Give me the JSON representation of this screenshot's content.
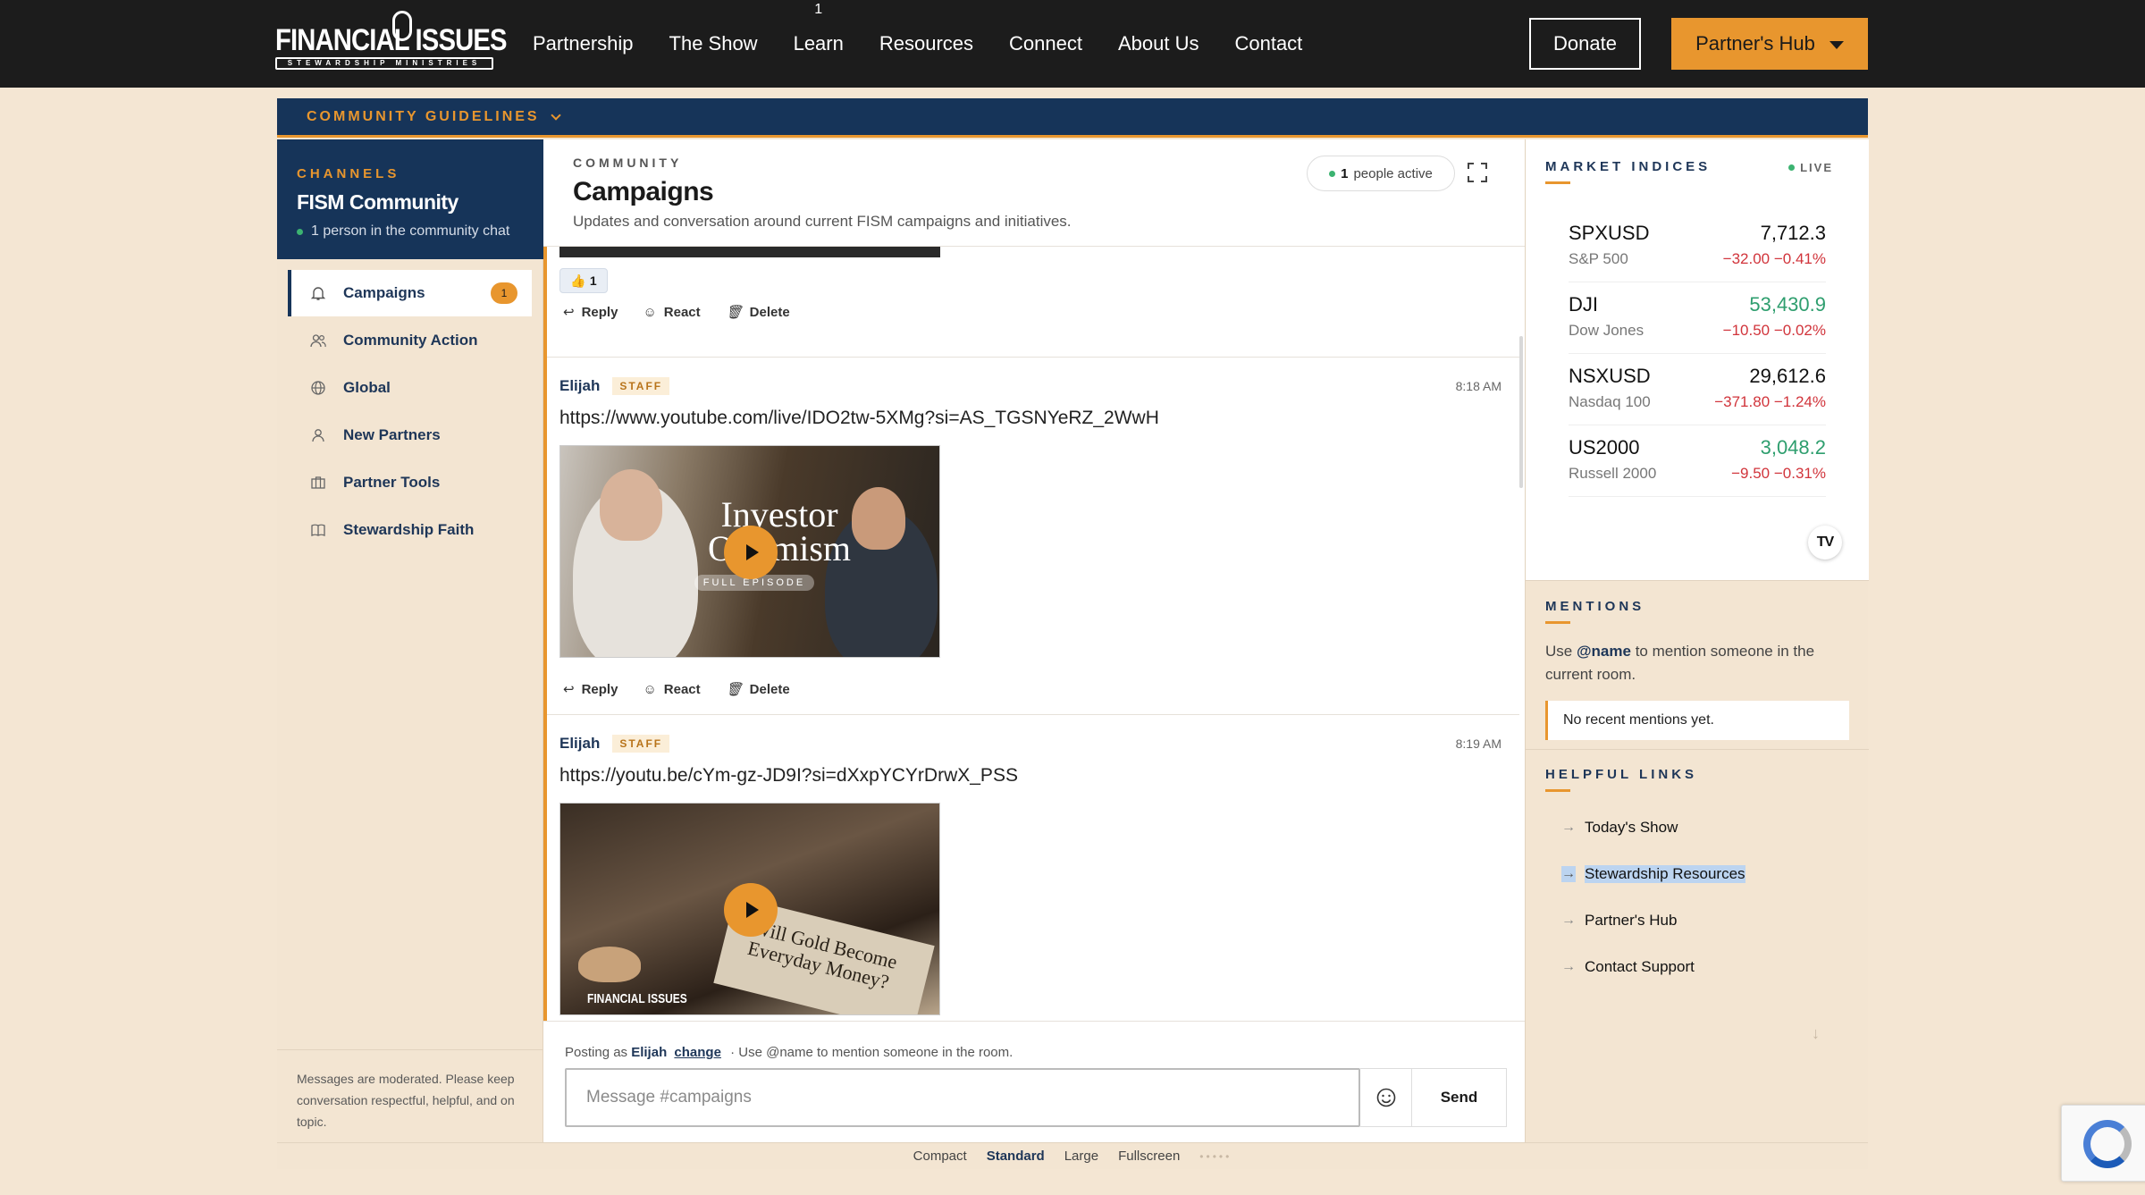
{
  "brand": {
    "logo_main": "FINANCIAL ISSUES",
    "logo_sub": "STEWARDSHIP MINISTRIES"
  },
  "nav": {
    "items": [
      "Partnership",
      "The Show",
      "Learn",
      "Resources",
      "Connect",
      "About Us",
      "Contact"
    ],
    "learn_badge": "1",
    "donate": "Donate",
    "partners_hub": "Partner's Hub"
  },
  "guidelines": {
    "label": "COMMUNITY GUIDELINES"
  },
  "sidebar": {
    "label": "CHANNELS",
    "title": "FISM Community",
    "subtitle": "1 person in the community chat",
    "items": [
      {
        "label": "Campaigns",
        "icon": "bell-icon",
        "count": "1"
      },
      {
        "label": "Community Action",
        "icon": "users-icon"
      },
      {
        "label": "Global",
        "icon": "globe-icon"
      },
      {
        "label": "New Partners",
        "icon": "user-icon"
      },
      {
        "label": "Partner Tools",
        "icon": "briefcase-icon"
      },
      {
        "label": "Stewardship Faith",
        "icon": "book-icon"
      }
    ],
    "footer": "Messages are moderated. Please keep conversation respectful, helpful, and on topic."
  },
  "chat": {
    "label": "COMMUNITY",
    "title": "Campaigns",
    "description": "Updates and conversation around current FISM campaigns and initiatives.",
    "active_count": "1",
    "active_text": "people active",
    "actions": {
      "reply": "Reply",
      "react": "React",
      "delete": "Delete"
    },
    "messages": [
      {
        "reaction_emoji": "👍",
        "reaction_count": "1"
      },
      {
        "author": "Elijah",
        "role": "STAFF",
        "time": "8:18 AM",
        "text": "https://www.youtube.com/live/IDO2tw-5XMg?si=AS_TGSNYeRZ_2WwH",
        "video_title": "Investor Optimism",
        "video_sub": "FULL EPISODE"
      },
      {
        "author": "Elijah",
        "role": "STAFF",
        "time": "8:19 AM",
        "text": "https://youtu.be/cYm-gz-JD9I?si=dXxpYCYrDrwX_PSS",
        "video_headline": "Will Gold Become Everyday Money?",
        "video_logo": "FINANCIAL ISSUES"
      }
    ],
    "composer": {
      "posting_as": "Posting as",
      "user": "Elijah",
      "change": "change",
      "hint": "· Use @name to mention someone in the room.",
      "placeholder": "Message #campaigns",
      "send": "Send"
    }
  },
  "market": {
    "title": "MARKET INDICES",
    "live": "LIVE",
    "tickers": [
      {
        "symbol": "SPXUSD",
        "name": "S&P 500",
        "price": "7,712.3",
        "change": "−32.00  −0.41%",
        "up": false
      },
      {
        "symbol": "DJI",
        "name": "Dow Jones",
        "price": "53,430.9",
        "change": "−10.50  −0.02%",
        "up": true
      },
      {
        "symbol": "NSXUSD",
        "name": "Nasdaq 100",
        "price": "29,612.6",
        "change": "−371.80  −1.24%",
        "up": false
      },
      {
        "symbol": "US2000",
        "name": "Russell 2000",
        "price": "3,048.2",
        "change": "−9.50  −0.31%",
        "up": true
      }
    ],
    "tv_logo": "TV"
  },
  "mentions": {
    "title": "MENTIONS",
    "text_pre": "Use",
    "text_bold": "@name",
    "text_post": "to mention someone in the current room.",
    "empty": "No recent mentions yet."
  },
  "helpful_links": {
    "title": "HELPFUL LINKS",
    "items": [
      "Today's Show",
      "Stewardship Resources",
      "Partner's Hub",
      "Contact Support"
    ]
  },
  "size_options": {
    "items": [
      "Compact",
      "Standard",
      "Large",
      "Fullscreen"
    ],
    "selected": "Standard"
  },
  "colors": {
    "navy": "#163459",
    "accent": "#e8962e",
    "background": "#f4e6d3",
    "up": "#2e9e6e",
    "down": "#d1343b"
  }
}
